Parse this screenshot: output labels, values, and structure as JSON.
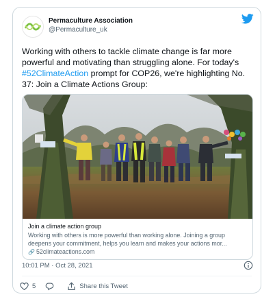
{
  "author": {
    "name": "Permaculture Association",
    "handle": "@Permaculture_uk",
    "avatar_icon": "permaculture-logo-icon"
  },
  "tweet": {
    "text_part1": "Working with others to tackle climate change is far more powerful and motivating than struggling alone. For today's ",
    "hashtag": "#52ClimateAction",
    "text_part2": " prompt for COP26, we're highlighting No. 37: Join a Climate Actions Group:",
    "timestamp": "10:01 PM · Oct 28, 2021"
  },
  "card": {
    "title": "Join a climate action group",
    "description": "Working with others is more powerful than working alone. Joining a group deepens your commitment, helps you learn and makes your actions mor...",
    "domain": "52climateactions.com",
    "image_alt": "group of people linking arms between trees in a park"
  },
  "actions": {
    "like_count": "5",
    "share_label": "Share this Tweet"
  },
  "colors": {
    "accent": "#1d9bf0",
    "text": "#0f1419",
    "muted": "#536471",
    "border": "#cfd9de"
  }
}
